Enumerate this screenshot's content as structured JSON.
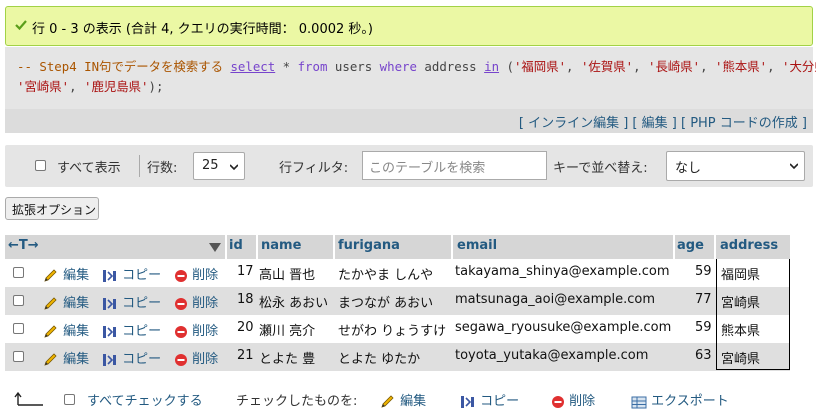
{
  "success": {
    "message": "行 0 - 3 の表示 (合計 4, クエリの実行時間： 0.0002 秒。)"
  },
  "sql": {
    "line1": [
      {
        "t": "-- Step4 IN句でデータを検索する ",
        "c": "c-cmt"
      },
      {
        "t": "select",
        "c": "c-fn"
      },
      {
        "t": " * ",
        "c": "c-op"
      },
      {
        "t": "from",
        "c": "c-kw"
      },
      {
        "t": " users ",
        "c": "c-id"
      },
      {
        "t": "where",
        "c": "c-kw"
      },
      {
        "t": " address ",
        "c": "c-id"
      },
      {
        "t": "in",
        "c": "c-fn"
      },
      {
        "t": " (",
        "c": "c-op"
      },
      {
        "t": "'福岡県'",
        "c": "c-str"
      },
      {
        "t": ", ",
        "c": "c-op"
      },
      {
        "t": "'佐賀県'",
        "c": "c-str"
      },
      {
        "t": ", ",
        "c": "c-op"
      },
      {
        "t": "'長崎県'",
        "c": "c-str"
      },
      {
        "t": ", ",
        "c": "c-op"
      },
      {
        "t": "'熊本県'",
        "c": "c-str"
      },
      {
        "t": ", ",
        "c": "c-op"
      },
      {
        "t": "'大分県'",
        "c": "c-str"
      },
      {
        "t": ",",
        "c": "c-op"
      }
    ],
    "line2": [
      {
        "t": "'宮崎県'",
        "c": "c-str"
      },
      {
        "t": ", ",
        "c": "c-op"
      },
      {
        "t": "'鹿児島県'",
        "c": "c-str"
      },
      {
        "t": ");",
        "c": "c-op"
      }
    ]
  },
  "query_actions": {
    "inline_edit": "インライン編集",
    "edit": "編集",
    "php_code": "PHP コードの作成"
  },
  "nav": {
    "show_all": "すべて表示",
    "rows_label": "行数:",
    "rows_value": "25",
    "filter_label": "行フィルタ:",
    "filter_placeholder": "このテーブルを検索",
    "sort_label": "キーで並べ替え:",
    "sort_value": "なし"
  },
  "extended_options": "拡張オプション",
  "table": {
    "arrows": "←T→",
    "columns": [
      "id",
      "name",
      "furigana",
      "email",
      "age",
      "address"
    ],
    "action_labels": {
      "edit": "編集",
      "copy": "コピー",
      "delete": "削除"
    },
    "rows": [
      {
        "id": "17",
        "name": "高山 晋也",
        "furigana": "たかやま しんや",
        "email": "takayama_shinya@example.com",
        "age": "59",
        "address": "福岡県"
      },
      {
        "id": "18",
        "name": "松永 あおい",
        "furigana": "まつなが あおい",
        "email": "matsunaga_aoi@example.com",
        "age": "77",
        "address": "宮崎県"
      },
      {
        "id": "20",
        "name": "瀬川 亮介",
        "furigana": "せがわ りょうすけ",
        "email": "segawa_ryousuke@example.com",
        "age": "59",
        "address": "熊本県"
      },
      {
        "id": "21",
        "name": "とよた 豊",
        "furigana": "とよた ゆたか",
        "email": "toyota_yutaka@example.com",
        "age": "63",
        "address": "宮崎県"
      }
    ]
  },
  "bottom": {
    "check_all": "すべてチェックする",
    "with_selected": "チェックしたものを:",
    "edit": "編集",
    "copy": "コピー",
    "delete": "削除",
    "export": "エクスポート"
  },
  "colors": {
    "link": "#235a81",
    "success_bg": "#ebf8a4",
    "header_bg": "#d6d6d6",
    "row_even_bg": "#dfdfdf"
  }
}
